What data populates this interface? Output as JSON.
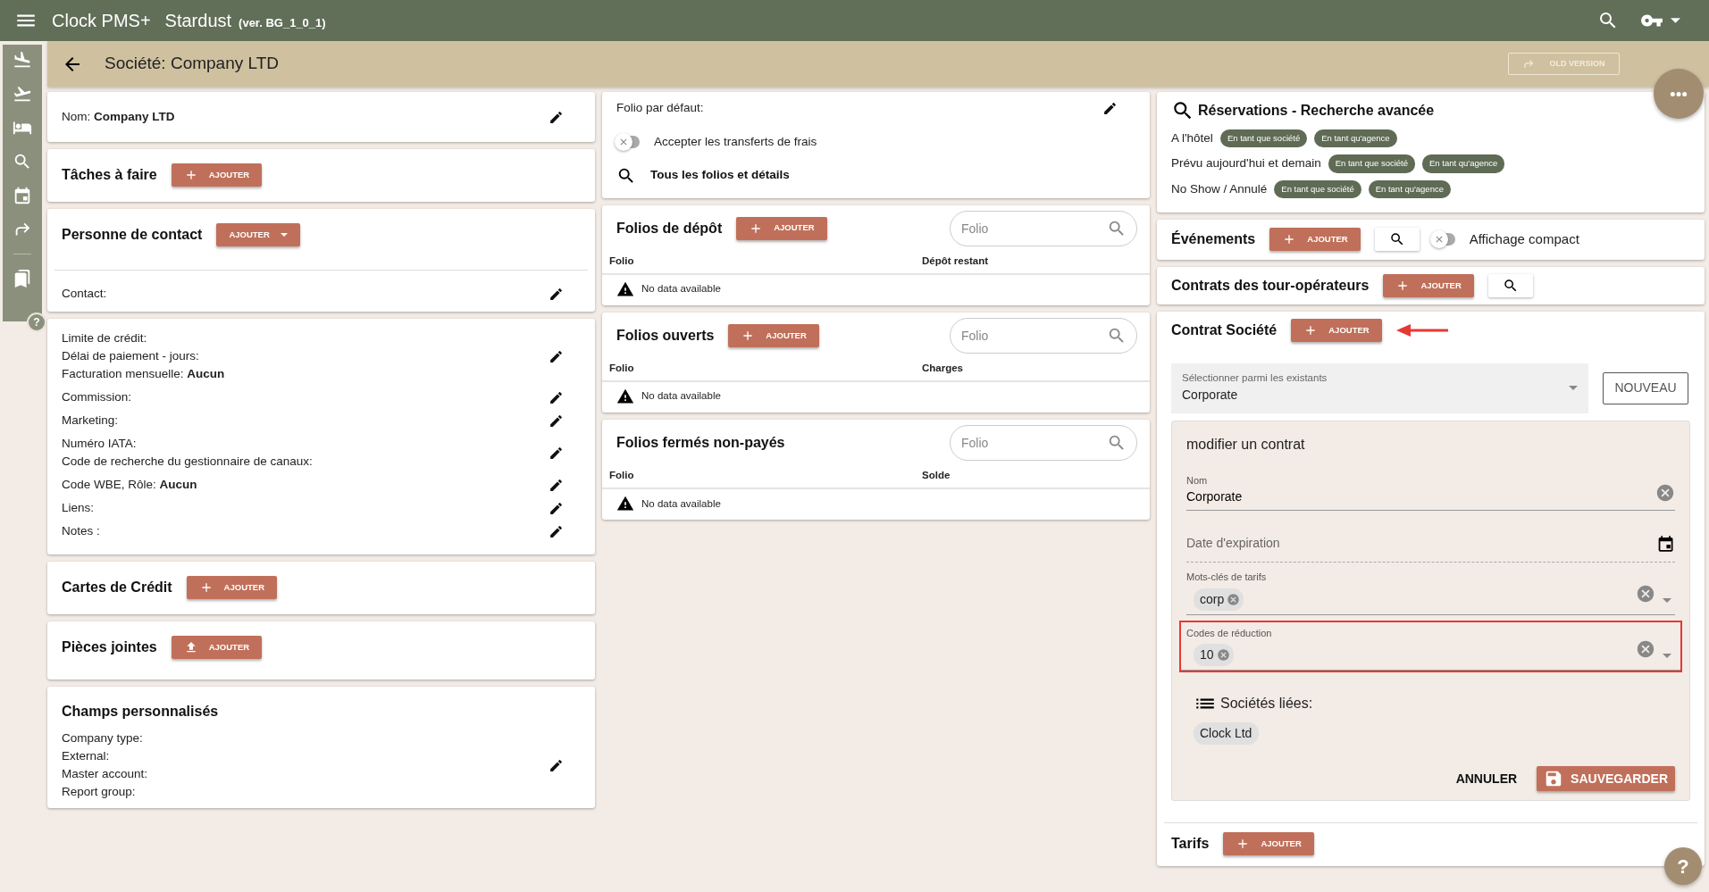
{
  "app_bar": {
    "title": "Clock PMS+",
    "product": "Stardust",
    "version": "(ver. BG_1_0_1)"
  },
  "rail": {
    "help_badge": "?"
  },
  "page_header": {
    "title": "Société: Company LTD",
    "old_version_button": "OLD VERSION"
  },
  "left_column": {
    "company_name": "Nom: **Company LTD**",
    "tasks": {
      "title": "Tâches à faire",
      "button": {
        "label": "AJOUTER",
        "kind": "add"
      }
    },
    "contacts": {
      "title": "Personne de contact",
      "button": {
        "label": "AJOUTER",
        "kind": "dropdown"
      },
      "contact_label": "Contact:"
    },
    "details": [
      [
        "Limite de crédit:",
        "Délai de paiement - jours:",
        "Facturation mensuelle: **Aucun**"
      ],
      [
        "Commission:"
      ],
      [
        "Marketing:"
      ],
      [
        "Numéro IATA:",
        "Code de recherche du gestionnaire de canaux:"
      ],
      [
        "Code WBE, Rôle: **Aucun**"
      ],
      [
        "Liens:"
      ],
      [
        "Notes :"
      ]
    ],
    "credit_cards": {
      "title": "Cartes de Crédit",
      "button": {
        "label": "AJOUTER",
        "kind": "add"
      }
    },
    "attachments": {
      "title": "Pièces jointes",
      "button": {
        "label": "AJOUTER",
        "kind": "upload"
      }
    },
    "custom_fields": {
      "title": "Champs personnalisés",
      "lines": [
        "Company type:",
        "External:",
        "Master account:",
        "Report group:"
      ]
    }
  },
  "middle_column": {
    "folio_settings": {
      "default_folio_label": "Folio par défaut:",
      "accept_transfers": {
        "label": "Accepter les transferts de frais",
        "on": false
      },
      "all_folios_link": "Tous les folios et détails"
    },
    "folio_tables": [
      {
        "title": "Folios de dépôt",
        "button": {
          "label": "AJOUTER",
          "kind": "add"
        },
        "search_placeholder": "Folio",
        "columns": [
          "Folio",
          "Dépôt restant"
        ],
        "empty_message": "No data available"
      },
      {
        "title": "Folios ouverts",
        "button": {
          "label": "AJOUTER",
          "kind": "add"
        },
        "search_placeholder": "Folio",
        "columns": [
          "Folio",
          "Charges"
        ],
        "empty_message": "No data available"
      },
      {
        "title": "Folios fermés non-payés",
        "search_placeholder": "Folio",
        "columns": [
          "Folio",
          "Solde"
        ],
        "empty_message": "No data available"
      }
    ]
  },
  "right_column": {
    "reservations_search": {
      "title": "Réservations - Recherche avancée",
      "rows": [
        {
          "label": "A l'hôtel",
          "chips": [
            "En tant que société",
            "En tant qu'agence"
          ]
        },
        {
          "label": "Prévu aujourd'hui et demain",
          "chips": [
            "En tant que société",
            "En tant qu'agence"
          ]
        },
        {
          "label": "No Show / Annulé",
          "chips": [
            "En tant que société",
            "En tant qu'agence"
          ]
        }
      ]
    },
    "events": {
      "title": "Événements",
      "button": {
        "label": "AJOUTER",
        "kind": "add"
      },
      "compact_view": {
        "label": "Affichage compact",
        "on": false
      }
    },
    "tour_operator_contracts": {
      "title": "Contrats des tour-opérateurs",
      "button": {
        "label": "AJOUTER",
        "kind": "add"
      }
    },
    "company_contract": {
      "title": "Contrat Société",
      "button": {
        "label": "AJOUTER",
        "kind": "add"
      },
      "arrow_annotation": true,
      "select": {
        "label": "Sélectionner parmi les existants",
        "value": "Corporate"
      },
      "new_button": "NOUVEAU",
      "editor": {
        "title": "modifier un contrat",
        "name_field": {
          "label": "Nom",
          "value": "Corporate"
        },
        "expiry_field": {
          "placeholder": "Date d'expiration"
        },
        "chip_fields": [
          {
            "label": "Mots-clés de tarifs",
            "chips": [
              "corp"
            ],
            "highlighted": false
          },
          {
            "label": "Codes de réduction",
            "chips": [
              "10"
            ],
            "highlighted": true
          }
        ],
        "linked_companies": {
          "title": "Sociétés liées:",
          "chips": [
            "Clock Ltd"
          ]
        },
        "cancel_button": "ANNULER",
        "save_button": "SAUVEGARDER"
      }
    },
    "rates": {
      "title": "Tarifs",
      "button": {
        "label": "AJOUTER",
        "kind": "add"
      }
    }
  },
  "help_button": "?"
}
